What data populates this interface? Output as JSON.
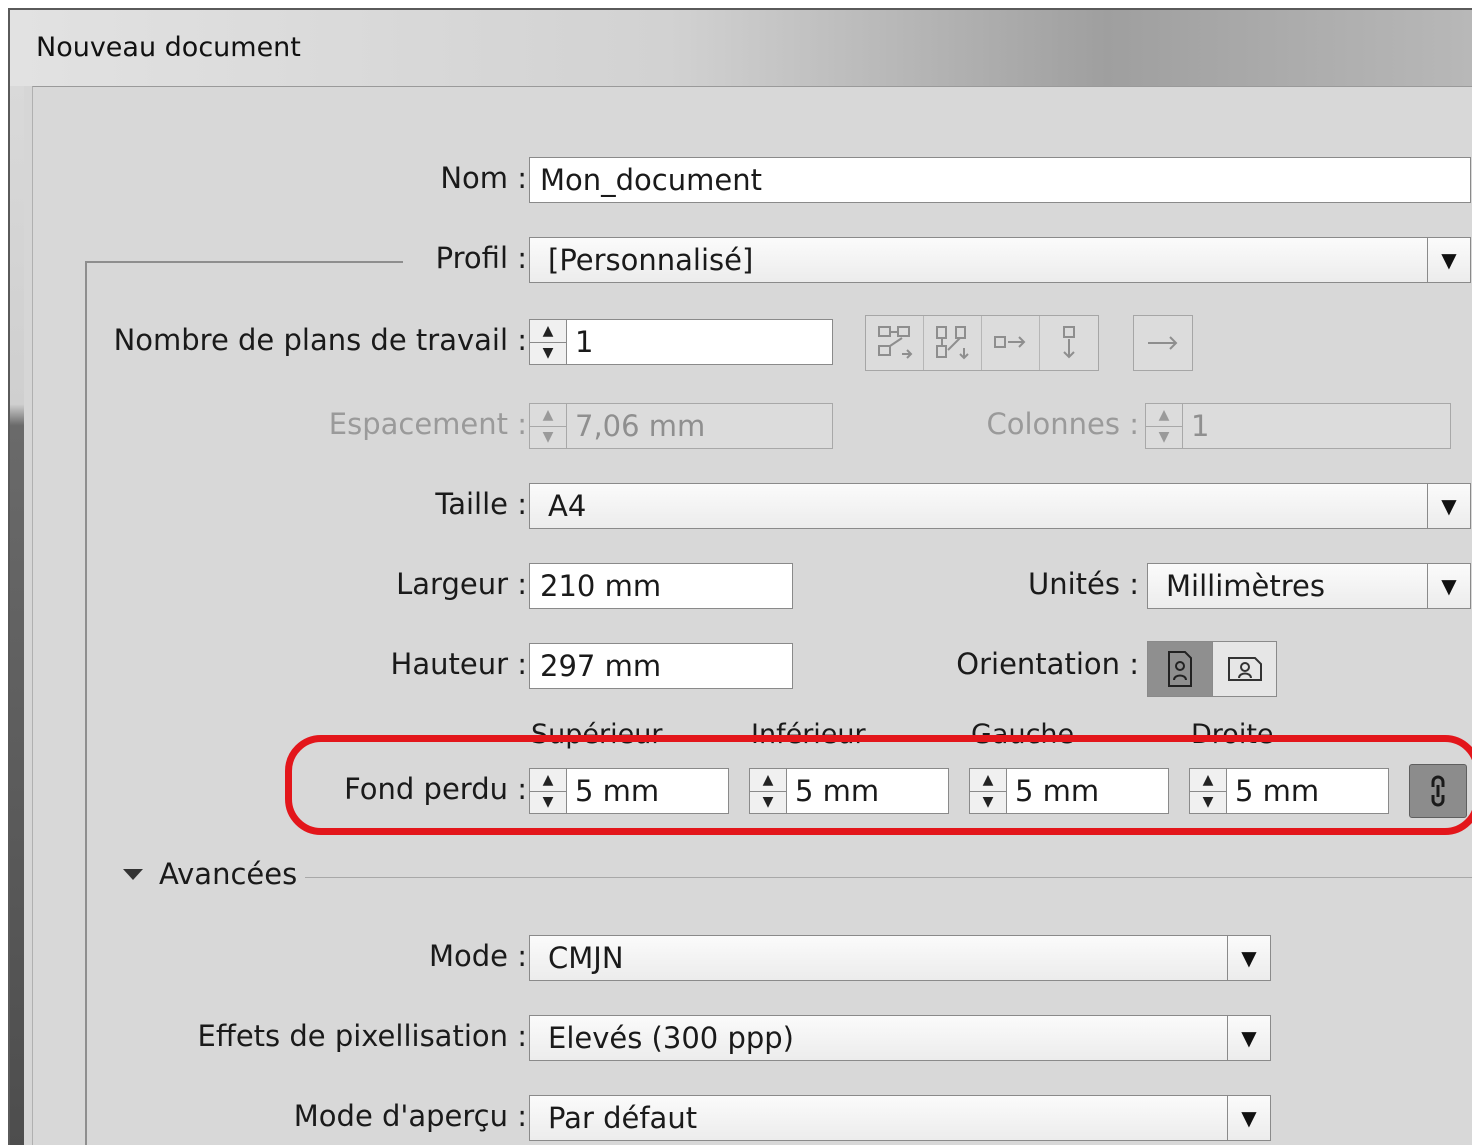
{
  "window": {
    "title": "Nouveau document"
  },
  "form": {
    "name": {
      "label": "Nom :",
      "value": "Mon_document"
    },
    "profile": {
      "label": "Profil :",
      "value": "[Personnalisé]"
    },
    "artboards": {
      "label": "Nombre de plans de travail :",
      "value": "1"
    },
    "spacing": {
      "label": "Espacement :",
      "value": "7,06 mm"
    },
    "columns": {
      "label": "Colonnes :",
      "value": "1"
    },
    "size": {
      "label": "Taille :",
      "value": "A4"
    },
    "width": {
      "label": "Largeur :",
      "value": "210 mm"
    },
    "height": {
      "label": "Hauteur :",
      "value": "297 mm"
    },
    "units": {
      "label": "Unités :",
      "value": "Millimètres"
    },
    "orientation": {
      "label": "Orientation :",
      "selected": "portrait"
    },
    "bleed": {
      "label": "Fond perdu :",
      "top": {
        "label": "Supérieur",
        "value": "5 mm"
      },
      "bottom": {
        "label": "Inférieur",
        "value": "5 mm"
      },
      "left": {
        "label": "Gauche",
        "value": "5 mm"
      },
      "right": {
        "label": "Droite",
        "value": "5 mm"
      }
    }
  },
  "advanced": {
    "label": "Avancées",
    "expanded": true,
    "mode": {
      "label": "Mode :",
      "value": "CMJN"
    },
    "raster_effects": {
      "label": "Effets de pixellisation :",
      "value": "Elevés (300 ppp)"
    },
    "preview_mode": {
      "label": "Mode d'aperçu :",
      "value": "Par défaut"
    }
  },
  "colors": {
    "highlight": "#e3161b",
    "panel": "#d8d8d8",
    "field": "#ffffff"
  },
  "icons": {
    "arrange_grid_by_row": "grid-by-row-icon",
    "arrange_grid_by_column": "grid-by-column-icon",
    "arrange_by_row": "arrange-by-row-icon",
    "arrange_by_column": "arrange-by-column-icon",
    "right_to_left": "right-to-left-arrow-icon",
    "portrait": "portrait-orientation-icon",
    "landscape": "landscape-orientation-icon",
    "link": "link-icon"
  }
}
